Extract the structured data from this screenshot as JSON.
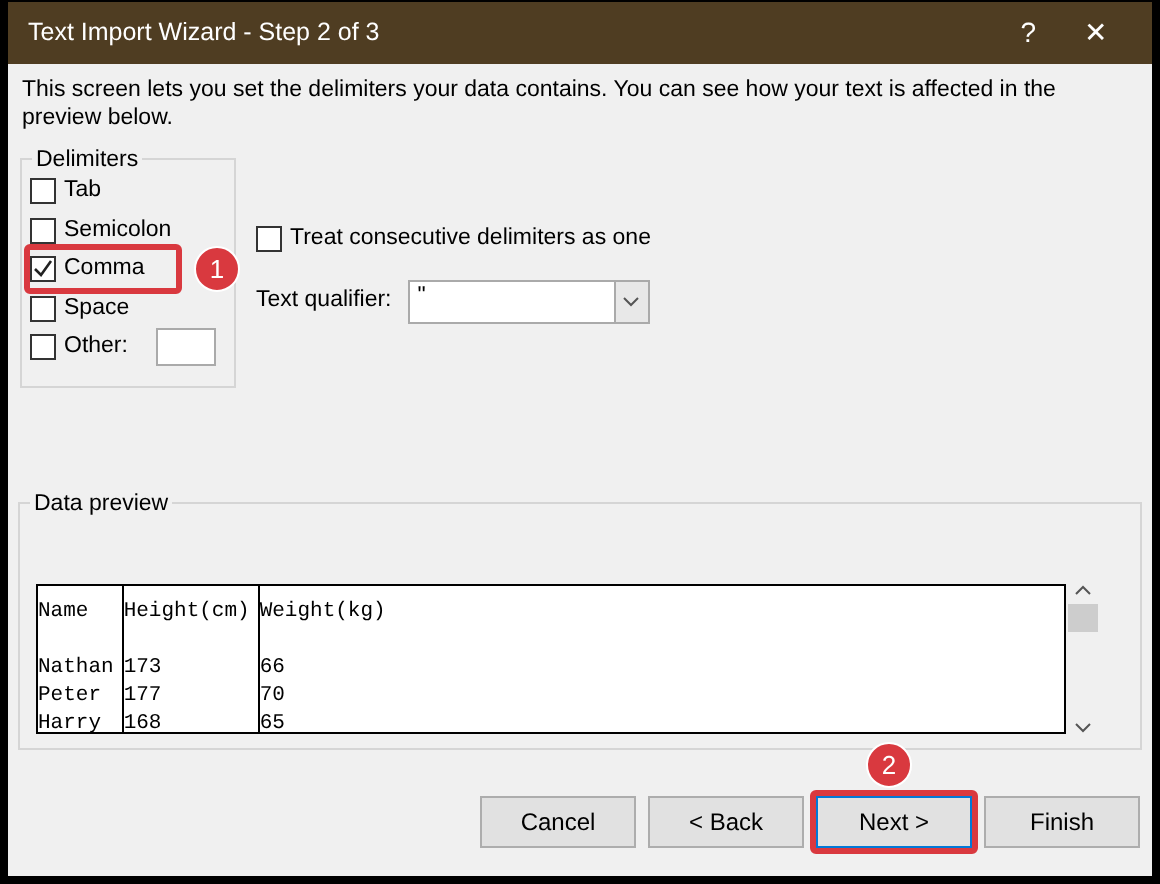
{
  "window": {
    "title": "Text Import Wizard - Step 2 of 3",
    "help": "?",
    "close": "✕"
  },
  "intro": "This screen lets you set the delimiters your data contains.  You can see how your text is affected in the preview below.",
  "delimiters": {
    "title": "Delimiters",
    "items": [
      {
        "label": "Tab",
        "checked": false
      },
      {
        "label": "Semicolon",
        "checked": false
      },
      {
        "label": "Comma",
        "checked": true,
        "annotation": "1"
      },
      {
        "label": "Space",
        "checked": false
      },
      {
        "label": "Other:",
        "checked": false,
        "kind": "other"
      }
    ]
  },
  "consecutive": {
    "label": "Treat consecutive delimiters as one",
    "checked": false
  },
  "qualifier": {
    "label": "Text qualifier:",
    "value": "\""
  },
  "preview": {
    "title": "Data preview",
    "columns": [
      "Name",
      "Height(cm)",
      "Weight(kg)"
    ],
    "rows": [
      [
        "Nathan",
        "173",
        "66"
      ],
      [
        "Peter",
        "177",
        "70"
      ],
      [
        "Harry",
        "168",
        "65"
      ]
    ]
  },
  "buttons": [
    {
      "label": "Cancel",
      "selected": false
    },
    {
      "label": "< Back",
      "selected": false
    },
    {
      "label": "Next >",
      "selected": true,
      "annotation": "2"
    },
    {
      "label": "Finish",
      "selected": false
    }
  ]
}
